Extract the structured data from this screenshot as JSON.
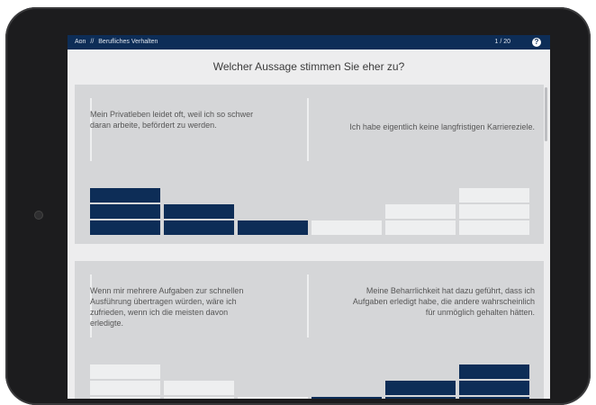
{
  "header": {
    "crumb_root": "Aon",
    "crumb_sep": "//",
    "crumb_section": "Berufliches Verhalten",
    "progress": "1 / 20",
    "help_icon": "question-circle-icon",
    "help_label": "?"
  },
  "question": "Welcher Aussage stimmen Sie eher zu?",
  "colors": {
    "navy": "#0d2d57",
    "panel": "#d5d6d8",
    "bar_empty": "#eeeff0",
    "background": "#ededee"
  },
  "pairs": [
    {
      "left_statement": "Mein Privatleben leidet oft, weil ich so schwer daran arbeite, befördert zu werden.",
      "right_statement": "Ich habe eigentlich keine langfristigen Karriereziele.",
      "scale": [
        3,
        2,
        1,
        1,
        2,
        3
      ],
      "selected_option": null
    },
    {
      "left_statement": "Wenn mir mehrere Aufgaben zur schnellen Ausführung übertragen würden, wäre ich zufrieden, wenn ich die meisten davon erledigte.",
      "right_statement": "Meine Beharrlichkeit hat dazu geführt, dass ich Aufgaben erledigt habe, die andere wahrscheinlich für unmöglich gehalten hätten.",
      "scale": [
        3,
        2,
        1,
        1,
        2,
        3
      ],
      "selected_option": null
    }
  ]
}
